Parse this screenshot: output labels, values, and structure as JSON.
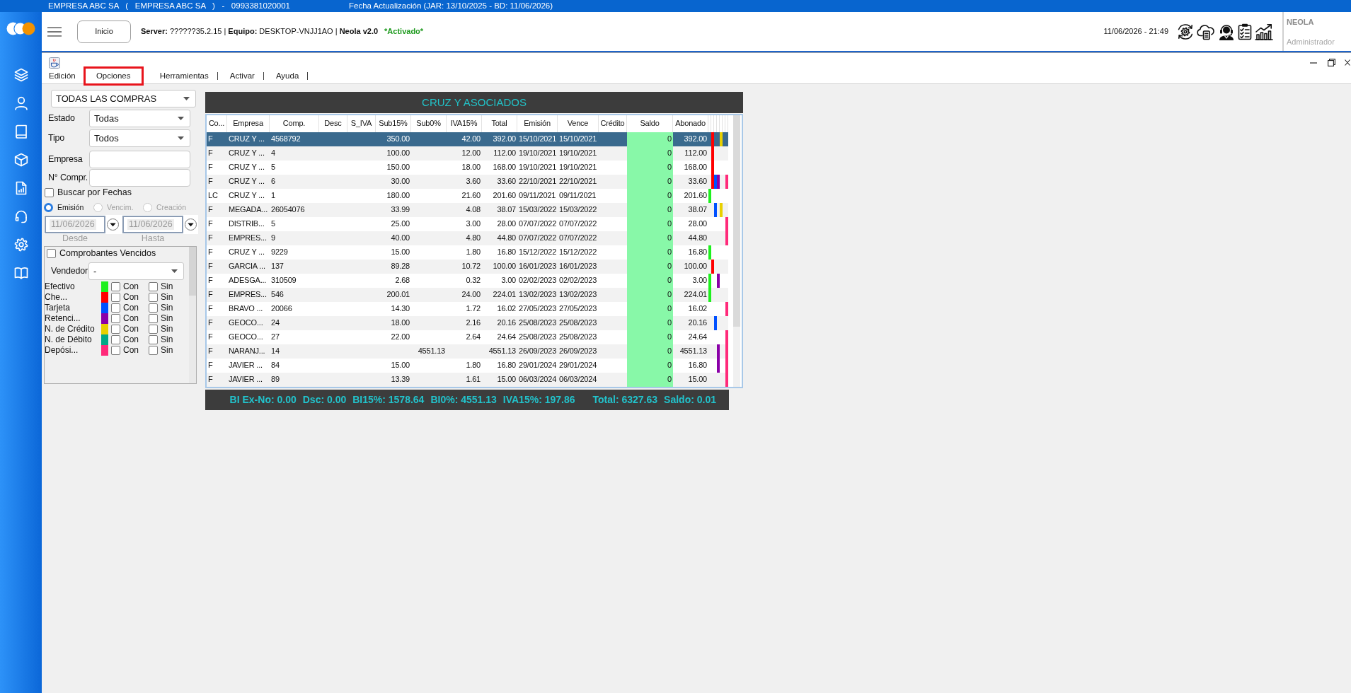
{
  "top_bar": {
    "company": "EMPRESA ABC SA   (   EMPRESA ABC SA   )   -   0993381020001",
    "update_info": "Fecha Actualización (JAR: 13/10/2025 - BD: 11/06/2026)"
  },
  "header": {
    "home_button": "Inicio",
    "connection": "**Server:** ??????35.2.15 | **Equipo:** DESKTOP-VNJJ1AO | **Neola v2.0**",
    "activation": "*Activado*",
    "datetime": "11/06/2026 - 21:49",
    "user": {
      "name": "NEOLA",
      "role": "Administrador"
    }
  },
  "menu": [
    {
      "label": "Edición",
      "separator": false,
      "highlighted": false
    },
    {
      "label": "Opciones",
      "separator": false,
      "highlighted": true
    },
    {
      "label": "Herramientas",
      "separator": true,
      "highlighted": false
    },
    {
      "label": "Activar",
      "separator": true,
      "highlighted": false
    },
    {
      "label": "Ayuda",
      "separator": true,
      "highlighted": false
    }
  ],
  "filters": {
    "scope": {
      "value": "TODAS LAS COMPRAS"
    },
    "status": {
      "label": "Estado",
      "value": "Todas"
    },
    "type": {
      "label": "Tipo",
      "value": "Todos"
    },
    "company": {
      "label": "Empresa"
    },
    "number": {
      "label": "N° Compr."
    },
    "date_search": {
      "label": "Buscar por Fechas",
      "checked": false
    },
    "date_types": [
      {
        "label": "Emisión",
        "selected": true,
        "disabled": false
      },
      {
        "label": "Vencim.",
        "selected": false,
        "disabled": true
      },
      {
        "label": "Creación",
        "selected": false,
        "disabled": true
      }
    ],
    "date_from": {
      "value": "11/06/2026",
      "caption": "Desde",
      "disabled": true
    },
    "date_to": {
      "value": "11/06/2026",
      "caption": "Hasta",
      "disabled": true
    },
    "overdue": {
      "label": "Comprobantes Vencidos",
      "checked": false
    },
    "seller": {
      "label": "Vendedor",
      "value": "-"
    },
    "payment_types": [
      {
        "label": "Efectivo",
        "color": "#1ef01e",
        "with": {
          "label": "Con",
          "checked": false
        },
        "without": {
          "label": "Sin",
          "checked": false
        }
      },
      {
        "label": "Che...",
        "color": "#ff0000",
        "with": {
          "label": "Con",
          "checked": false
        },
        "without": {
          "label": "Sin",
          "checked": false
        }
      },
      {
        "label": "Tarjeta",
        "color": "#0050ff",
        "with": {
          "label": "Con",
          "checked": false
        },
        "without": {
          "label": "Sin",
          "checked": false
        }
      },
      {
        "label": "Retenci...",
        "color": "#8a00a8",
        "with": {
          "label": "Con",
          "checked": false
        },
        "without": {
          "label": "Sin",
          "checked": false
        }
      },
      {
        "label": "N. de Crédito",
        "color": "#e8d000",
        "with": {
          "label": "Con",
          "checked": false
        },
        "without": {
          "label": "Sin",
          "checked": false
        }
      },
      {
        "label": "N. de Débito",
        "color": "#00a886",
        "with": {
          "label": "Con",
          "checked": false
        },
        "without": {
          "label": "Sin",
          "checked": false
        }
      },
      {
        "label": "Depósi...",
        "color": "#ff2a7a",
        "with": {
          "label": "Con",
          "checked": false
        },
        "without": {
          "label": "Sin",
          "checked": false
        }
      }
    ]
  },
  "table": {
    "title": "CRUZ Y ASOCIADOS",
    "columns": [
      {
        "label": "Co...",
        "highlighted": false
      },
      {
        "label": "Empresa",
        "highlighted": false
      },
      {
        "label": "Comp.",
        "highlighted": false
      },
      {
        "label": "Desc",
        "highlighted": false
      },
      {
        "label": "S_IVA",
        "highlighted": false
      },
      {
        "label": "Sub15%",
        "highlighted": false
      },
      {
        "label": "Sub0%",
        "highlighted": false
      },
      {
        "label": "IVA15%",
        "highlighted": false
      },
      {
        "label": "Total",
        "highlighted": false
      },
      {
        "label": "Emisión",
        "highlighted": false
      },
      {
        "label": "Vence",
        "highlighted": false
      },
      {
        "label": "Crédito",
        "highlighted": false
      },
      {
        "label": "Saldo",
        "highlighted": true
      },
      {
        "label": "Abonado",
        "highlighted": false
      }
    ],
    "rows": [
      {
        "selected": true,
        "type": "F",
        "company": "CRUZ Y ...",
        "number": "4568792",
        "sub15": "350.00",
        "iva15": "42.00",
        "total": "392.00",
        "issued": "15/10/2021",
        "due": "15/10/2021",
        "balance": "0",
        "paid": "392.00",
        "markers": [
          false,
          true,
          false,
          false,
          true,
          false,
          false
        ]
      },
      {
        "selected": false,
        "type": "F",
        "company": "CRUZ Y ...",
        "number": "4",
        "sub15": "100.00",
        "iva15": "12.00",
        "total": "112.00",
        "issued": "19/10/2021",
        "due": "19/10/2021",
        "balance": "0",
        "paid": "112.00",
        "markers": [
          false,
          true,
          false,
          false,
          false,
          false,
          false
        ]
      },
      {
        "selected": false,
        "type": "F",
        "company": "CRUZ Y ...",
        "number": "5",
        "sub15": "150.00",
        "iva15": "18.00",
        "total": "168.00",
        "issued": "19/10/2021",
        "due": "19/10/2021",
        "balance": "0",
        "paid": "168.00",
        "markers": [
          false,
          true,
          false,
          false,
          false,
          false,
          false
        ]
      },
      {
        "selected": false,
        "type": "F",
        "company": "CRUZ Y ...",
        "number": "6",
        "sub15": "30.00",
        "iva15": "3.60",
        "total": "33.60",
        "issued": "22/10/2021",
        "due": "22/10/2021",
        "balance": "0",
        "paid": "33.60",
        "markers": [
          false,
          true,
          true,
          true,
          false,
          false,
          true
        ]
      },
      {
        "selected": false,
        "type": "LC",
        "company": "CRUZ Y ...",
        "number": "1",
        "sub15": "180.00",
        "iva15": "21.60",
        "total": "201.60",
        "issued": "09/11/2021",
        "due": "09/11/2021",
        "balance": "0",
        "paid": "201.60",
        "markers": [
          true,
          false,
          false,
          false,
          false,
          false,
          false
        ]
      },
      {
        "selected": false,
        "type": "F",
        "company": "MEGADA...",
        "number": "26054076",
        "sub15": "33.99",
        "iva15": "4.08",
        "total": "38.07",
        "issued": "15/03/2022",
        "due": "15/03/2022",
        "balance": "0",
        "paid": "38.07",
        "markers": [
          false,
          false,
          true,
          false,
          true,
          false,
          false
        ]
      },
      {
        "selected": false,
        "type": "F",
        "company": "DISTRIB...",
        "number": "5",
        "sub15": "25.00",
        "iva15": "3.00",
        "total": "28.00",
        "issued": "07/07/2022",
        "due": "07/07/2022",
        "balance": "0",
        "paid": "28.00",
        "markers": [
          false,
          false,
          false,
          false,
          false,
          false,
          true
        ]
      },
      {
        "selected": false,
        "type": "F",
        "company": "EMPRES...",
        "number": "9",
        "sub15": "40.00",
        "iva15": "4.80",
        "total": "44.80",
        "issued": "07/07/2022",
        "due": "07/07/2022",
        "balance": "0",
        "paid": "44.80",
        "markers": [
          false,
          false,
          false,
          false,
          false,
          false,
          true
        ]
      },
      {
        "selected": false,
        "type": "F",
        "company": "CRUZ Y ...",
        "number": "9229",
        "sub15": "15.00",
        "iva15": "1.80",
        "total": "16.80",
        "issued": "15/12/2022",
        "due": "15/12/2022",
        "balance": "0",
        "paid": "16.80",
        "markers": [
          true,
          false,
          false,
          false,
          false,
          false,
          false
        ]
      },
      {
        "selected": false,
        "type": "F",
        "company": "GARCIA ...",
        "number": "137",
        "sub15": "89.28",
        "iva15": "10.72",
        "total": "100.00",
        "issued": "16/01/2023",
        "due": "16/01/2023",
        "balance": "0",
        "paid": "100.00",
        "markers": [
          false,
          true,
          false,
          false,
          false,
          false,
          false
        ]
      },
      {
        "selected": false,
        "type": "F",
        "company": "ADESGA...",
        "number": "310509",
        "sub15": "2.68",
        "iva15": "0.32",
        "total": "3.00",
        "issued": "02/02/2023",
        "due": "02/02/2023",
        "balance": "0",
        "paid": "3.00",
        "markers": [
          true,
          false,
          false,
          true,
          false,
          false,
          false
        ]
      },
      {
        "selected": false,
        "type": "F",
        "company": "EMPRES...",
        "number": "546",
        "sub15": "200.01",
        "iva15": "24.00",
        "total": "224.01",
        "issued": "13/02/2023",
        "due": "13/02/2023",
        "balance": "0",
        "paid": "224.01",
        "markers": [
          true,
          false,
          false,
          false,
          false,
          false,
          false
        ]
      },
      {
        "selected": false,
        "type": "F",
        "company": "BRAVO ...",
        "number": "20066",
        "sub15": "14.30",
        "iva15": "1.72",
        "total": "16.02",
        "issued": "27/05/2023",
        "due": "27/05/2023",
        "balance": "0",
        "paid": "16.02",
        "markers": [
          false,
          false,
          false,
          false,
          false,
          false,
          true
        ]
      },
      {
        "selected": false,
        "type": "F",
        "company": "GEOCO...",
        "number": "24",
        "sub15": "18.00",
        "iva15": "2.16",
        "total": "20.16",
        "issued": "25/08/2023",
        "due": "25/08/2023",
        "balance": "0",
        "paid": "20.16",
        "markers": [
          false,
          false,
          true,
          false,
          false,
          false,
          false
        ]
      },
      {
        "selected": false,
        "type": "F",
        "company": "GEOCO...",
        "number": "27",
        "sub15": "22.00",
        "iva15": "2.64",
        "total": "24.64",
        "issued": "25/08/2023",
        "due": "25/08/2023",
        "balance": "0",
        "paid": "24.64",
        "markers": [
          false,
          false,
          false,
          false,
          false,
          false,
          true
        ]
      },
      {
        "selected": false,
        "type": "F",
        "company": "NARANJ...",
        "number": "14",
        "sub0": "4551.13",
        "total": "4551.13",
        "issued": "26/09/2023",
        "due": "26/09/2023",
        "balance": "0",
        "paid": "4551.13",
        "markers": [
          false,
          false,
          false,
          true,
          false,
          false,
          true
        ]
      },
      {
        "selected": false,
        "type": "F",
        "company": "JAVIER ...",
        "number": "84",
        "sub15": "15.00",
        "iva15": "1.80",
        "total": "16.80",
        "issued": "29/01/2024",
        "due": "29/01/2024",
        "balance": "0",
        "paid": "16.80",
        "markers": [
          false,
          false,
          false,
          true,
          false,
          false,
          true
        ]
      },
      {
        "selected": false,
        "type": "F",
        "company": "JAVIER ...",
        "number": "89",
        "sub15": "13.39",
        "iva15": "1.61",
        "total": "15.00",
        "issued": "06/03/2024",
        "due": "06/03/2024",
        "balance": "0",
        "paid": "15.00",
        "markers": [
          false,
          false,
          false,
          false,
          false,
          false,
          true
        ]
      }
    ],
    "totals": {
      "bases": [
        "BI Ex-No: 0.00",
        "Dsc: 0.00",
        "BI15%: 1578.64",
        "BI0%: 4551.13",
        "IVA15%: 197.86"
      ],
      "summary": [
        "Total: 6327.63",
        "Saldo: 0.01"
      ]
    }
  }
}
